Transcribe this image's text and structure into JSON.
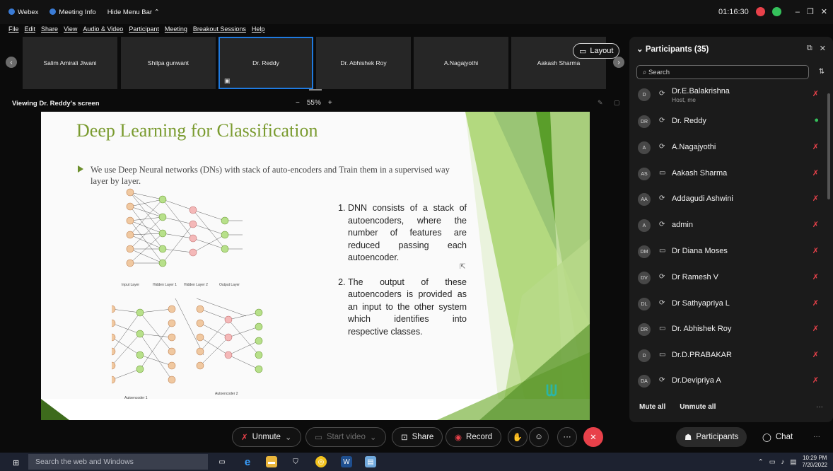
{
  "titlebar": {
    "app": "Webex",
    "meeting_info": "Meeting Info",
    "hide_menu": "Hide Menu Bar ⌃",
    "time": "01:16:30",
    "min": "–",
    "max": "❐",
    "close": "✕"
  },
  "menu": [
    "File",
    "Edit",
    "Share",
    "View",
    "Audio & Video",
    "Participant",
    "Meeting",
    "Breakout Sessions",
    "Help"
  ],
  "strip": {
    "tiles": [
      "Salim Amirali Jiwani",
      "Shilpa gunwant",
      "Dr. Reddy",
      "Dr. Abhishek Roy",
      "A.Nagajyothi",
      "Aakash Sharma"
    ],
    "active_index": 2,
    "layout_label": "Layout",
    "prev": "‹",
    "next": "›"
  },
  "view": {
    "viewing": "Viewing Dr. Reddy's screen",
    "zoom_minus": "−",
    "zoom": "55%",
    "zoom_plus": "+"
  },
  "slide": {
    "title": "Deep Learning for Classification",
    "bullet": "We use Deep Neural networks (DNs) with stack of auto-encoders and Train them in a supervised way layer by layer.",
    "points": [
      "DNN consists of a stack of autoencoders, where the number of features are reduced passing each autoencoder.",
      "The output of these autoencoders is provided as an input to the other system which identifies into respective classes."
    ],
    "captions": [
      "Input Layer",
      "Hidden Layer 1",
      "Hidden Layer 2",
      "Output Layer",
      "Autoencoder 1",
      "Autoencoder 2"
    ]
  },
  "sidebar": {
    "header": "Participants (35)",
    "search_placeholder": "Search",
    "participants": [
      {
        "initials": "D",
        "name": "Dr.E.Balakrishna",
        "sub": "Host, me",
        "device": "⟳",
        "mic": "muted"
      },
      {
        "initials": "DR",
        "name": "Dr. Reddy",
        "sub": "",
        "device": "⟳",
        "mic": "on"
      },
      {
        "initials": "A",
        "name": "A.Nagajyothi",
        "sub": "",
        "device": "⟳",
        "mic": "muted"
      },
      {
        "initials": "AS",
        "name": "Aakash Sharma",
        "sub": "",
        "device": "▭",
        "mic": "muted"
      },
      {
        "initials": "AA",
        "name": "Addagudi Ashwini",
        "sub": "",
        "device": "⟳",
        "mic": "muted"
      },
      {
        "initials": "A",
        "name": "admin",
        "sub": "",
        "device": "⟳",
        "mic": "muted"
      },
      {
        "initials": "DM",
        "name": "Dr Diana Moses",
        "sub": "",
        "device": "▭",
        "mic": "muted"
      },
      {
        "initials": "DV",
        "name": "Dr Ramesh V",
        "sub": "",
        "device": "⟳",
        "mic": "muted"
      },
      {
        "initials": "DL",
        "name": "Dr Sathyapriya L",
        "sub": "",
        "device": "⟳",
        "mic": "muted"
      },
      {
        "initials": "DR",
        "name": "Dr. Abhishek Roy",
        "sub": "",
        "device": "▭",
        "mic": "muted"
      },
      {
        "initials": "D",
        "name": "Dr.D.PRABAKAR",
        "sub": "",
        "device": "▭",
        "mic": "muted"
      },
      {
        "initials": "DA",
        "name": "Dr.Devipriya A",
        "sub": "",
        "device": "⟳",
        "mic": "muted"
      }
    ],
    "mute_all": "Mute all",
    "unmute_all": "Unmute all",
    "more": "···"
  },
  "controls": {
    "unmute": "Unmute",
    "start_video": "Start video",
    "share": "Share",
    "record": "Record",
    "participants": "Participants",
    "chat": "Chat",
    "more": "···"
  },
  "taskbar": {
    "search_placeholder": "Search the web and Windows",
    "time": "10:29 PM",
    "date": "7/20/2022"
  },
  "colors": {
    "accent_blue": "#1f7ae0",
    "red": "#e8414a",
    "green": "#35c15b",
    "slide_green": "#7a9b2f"
  }
}
